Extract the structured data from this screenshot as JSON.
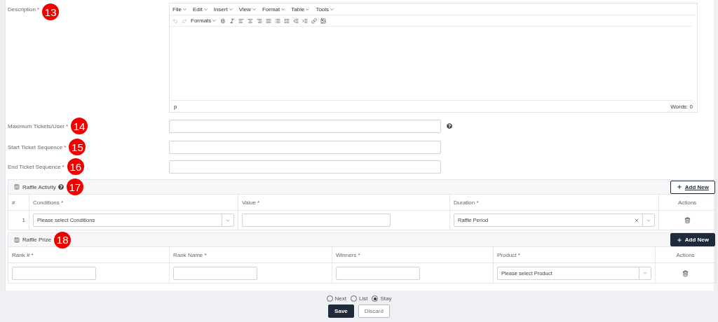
{
  "description": {
    "label": "Description",
    "required_mark": "*",
    "badge": "13",
    "editor": {
      "menu": [
        "File",
        "Edit",
        "Insert",
        "View",
        "Format",
        "Table",
        "Tools"
      ],
      "formats": "Formats",
      "path": "p",
      "word_count": "Words: 0"
    }
  },
  "fields": [
    {
      "label": "Maximum Tickets/User",
      "required_mark": "*",
      "badge": "14",
      "help": true
    },
    {
      "label": "Start Ticket Sequence",
      "required_mark": "*",
      "badge": "15",
      "help": false
    },
    {
      "label": "End Ticket Sequence",
      "required_mark": "*",
      "badge": "16",
      "help": false
    }
  ],
  "raffle_activity": {
    "title": "Raffle Activity",
    "help": true,
    "badge": "17",
    "add_button": {
      "label": "Add New",
      "kind": "outline"
    },
    "columns": [
      "#",
      "Conditions *",
      "Value *",
      "Duration *",
      "Actions"
    ],
    "rows": [
      {
        "number": "1",
        "condition": {
          "placeholder": "Please select Conditions"
        },
        "duration": {
          "value": "Raffle Period"
        }
      }
    ]
  },
  "raffle_prize": {
    "title": "Raffle Prize",
    "help": false,
    "badge": "18",
    "add_button": {
      "label": "Add New",
      "kind": "solid"
    },
    "columns": [
      "Rank # *",
      "Rank Name *",
      "Winners *",
      "Product *",
      "Actions"
    ],
    "rows": [
      {
        "product": {
          "placeholder": "Please select Product"
        }
      }
    ]
  },
  "after_save": [
    {
      "label": "Next",
      "selected": false
    },
    {
      "label": "List",
      "selected": false
    },
    {
      "label": "Stay",
      "selected": true
    }
  ],
  "buttons": {
    "save": "Save",
    "discard": "Discard"
  }
}
